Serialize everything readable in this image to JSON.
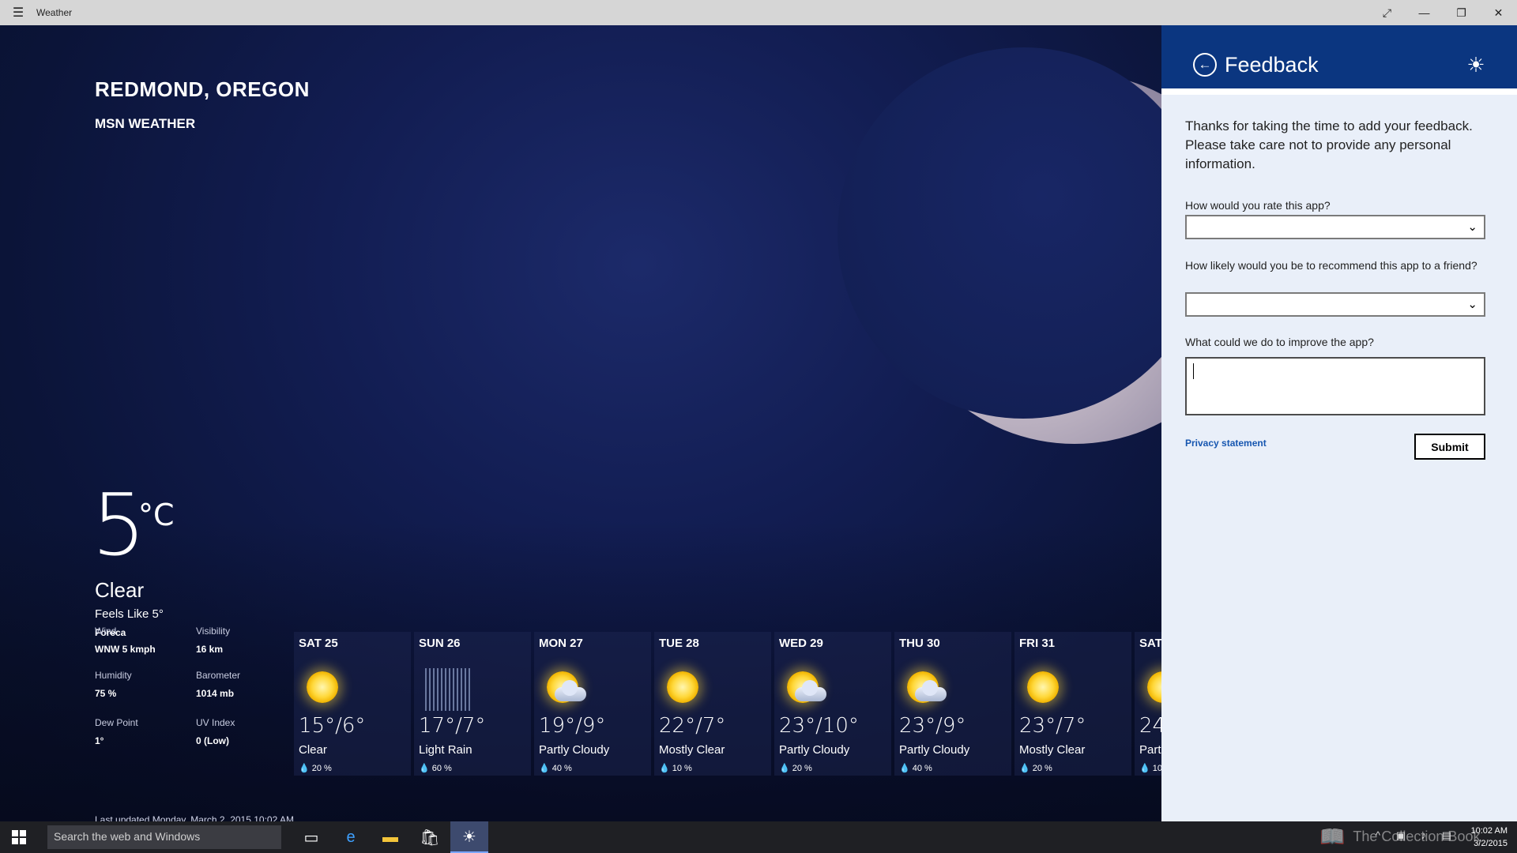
{
  "window": {
    "title": "Weather"
  },
  "location": {
    "name": "REDMOND, OREGON",
    "brand": "MSN WEATHER"
  },
  "current": {
    "temp": "5",
    "unit": "°C",
    "condition": "Clear",
    "feels_like": "Feels Like 5°",
    "source": "Foreca",
    "details": [
      {
        "label": "Wind",
        "value": "WNW 5 kmph"
      },
      {
        "label": "Visibility",
        "value": "16 km"
      },
      {
        "label": "Humidity",
        "value": "75 %"
      },
      {
        "label": "Barometer",
        "value": "1014 mb"
      },
      {
        "label": "Dew Point",
        "value": "1°"
      },
      {
        "label": "UV Index",
        "value": "0 (Low)"
      }
    ],
    "last_updated": "Last updated Monday, March 2, 2015 10:02 AM"
  },
  "forecast": [
    {
      "day": "SAT 25",
      "temp": "15°/6°",
      "desc": "Clear",
      "precip": "20 %",
      "icon": "sun-icon"
    },
    {
      "day": "SUN 26",
      "temp": "17°/7°",
      "desc": "Light Rain",
      "precip": "60 %",
      "icon": "rain-icon"
    },
    {
      "day": "MON 27",
      "temp": "19°/9°",
      "desc": "Partly Cloudy",
      "precip": "40 %",
      "icon": "partly-cloudy-icon"
    },
    {
      "day": "TUE 28",
      "temp": "22°/7°",
      "desc": "Mostly Clear",
      "precip": "10 %",
      "icon": "sun-icon"
    },
    {
      "day": "WED 29",
      "temp": "23°/10°",
      "desc": "Partly Cloudy",
      "precip": "20 %",
      "icon": "partly-cloudy-icon"
    },
    {
      "day": "THU 30",
      "temp": "23°/9°",
      "desc": "Partly Cloudy",
      "precip": "40 %",
      "icon": "partly-cloudy-icon"
    },
    {
      "day": "FRI 31",
      "temp": "23°/7°",
      "desc": "Mostly Clear",
      "precip": "20 %",
      "icon": "sun-icon"
    },
    {
      "day": "SAT",
      "temp": "24",
      "desc": "Part",
      "precip": "10",
      "icon": "sun-icon"
    }
  ],
  "feedback": {
    "title": "Feedback",
    "intro": "Thanks for taking the time to add your feedback. Please take care not to provide any personal information.",
    "q_rate": "How would you rate this app?",
    "q_recommend": "How likely would you be to recommend this app to a friend?",
    "q_improve": "What could we do to improve the app?",
    "rate_value": "",
    "recommend_value": "",
    "improve_value": "",
    "privacy": "Privacy statement",
    "submit": "Submit"
  },
  "taskbar": {
    "search_placeholder": "Search the web and Windows",
    "time": "10:02 AM",
    "date": "3/2/2015",
    "watermark": "The Collection Book"
  },
  "colors": {
    "accent": "#0b3680",
    "pane_bg": "#e9eff9",
    "link": "#1656b0"
  }
}
